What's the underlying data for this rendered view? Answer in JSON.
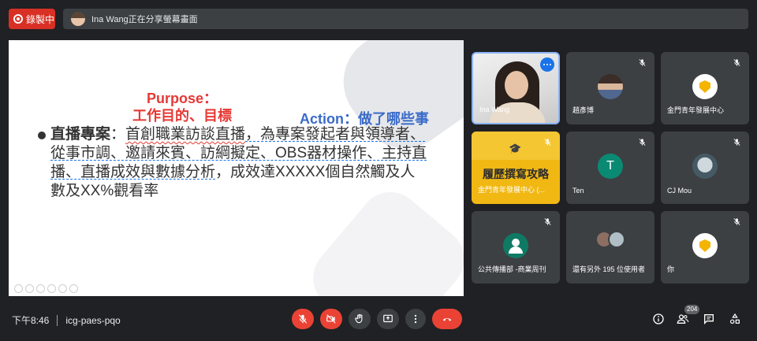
{
  "top": {
    "recording_label": "錄製中",
    "share_notice": "Ina Wang正在分享螢幕畫面"
  },
  "slide": {
    "purpose_line1": "Purpose：",
    "purpose_line2": "工作目的、目標",
    "action": "Action：做了哪些事",
    "bullet_head": "直播專案",
    "bullet_colon": "：",
    "seg1": "首創職業訪談直播",
    "seg2": "，為專案發起者與領導者、從事市調、邀請來賓、訪綱擬定、OBS器材操作、主持直播、直播成效與數據分析",
    "seg3": "，成效達XXXXX個自然觸及人數及XX%觀看率"
  },
  "participants": {
    "self_name": "Ina Wang",
    "p1": "趙彥博",
    "p2": "金門青年發展中心",
    "p3": "金門青年發展中心 (...",
    "p3_title": "履歷撰寫攻略",
    "p4": "Ten",
    "p4_initial": "T",
    "p5": "CJ Mou",
    "p6": "公共傳播部 -商業周刊",
    "p7": "還有另外 195 位使用者",
    "p8": "你"
  },
  "bottom": {
    "time": "下午8:46",
    "meeting_code": "icg-paes-pqo",
    "participant_count": "204"
  },
  "colors": {
    "background": "#202124",
    "tile": "#3c4043",
    "danger": "#ea4335",
    "recording": "#d93025",
    "accent": "#8ab4f8",
    "purpose_red": "#e53935",
    "action_blue": "#3a6bc9"
  },
  "icons": [
    "record-icon",
    "mic-off-icon",
    "video-off-icon",
    "raise-hand-icon",
    "present-icon",
    "more-options-icon",
    "end-call-icon",
    "info-icon",
    "people-icon",
    "chat-icon",
    "activities-icon"
  ]
}
